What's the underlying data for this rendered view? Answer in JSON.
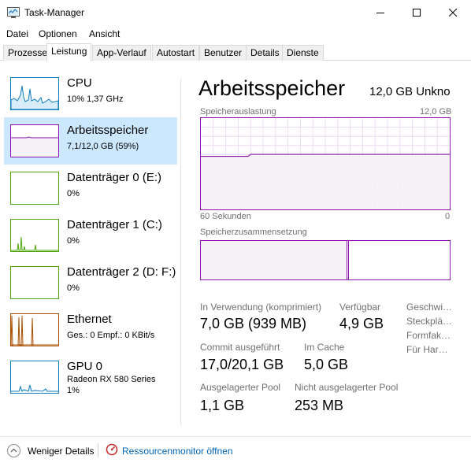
{
  "window": {
    "title": "Task-Manager",
    "app_icon": "task-manager-icon",
    "controls": {
      "minimize": "minimize-icon",
      "maximize": "maximize-icon",
      "close": "close-icon"
    }
  },
  "menu": [
    "Datei",
    "Optionen",
    "Ansicht"
  ],
  "tabs": [
    {
      "label": "Prozesse",
      "active": false
    },
    {
      "label": "Leistung",
      "active": true
    },
    {
      "label": "App-Verlauf",
      "active": false
    },
    {
      "label": "Autostart",
      "active": false
    },
    {
      "label": "Benutzer",
      "active": false
    },
    {
      "label": "Details",
      "active": false
    },
    {
      "label": "Dienste",
      "active": false
    }
  ],
  "devices": [
    {
      "name": "CPU",
      "line1": "10% 1,37 GHz",
      "line2": "",
      "color": "#117dbb"
    },
    {
      "name": "Arbeitsspeicher",
      "line1": "7,1/12,0 GB (59%)",
      "line2": "",
      "color": "#8b12ae",
      "selected": true
    },
    {
      "name": "Datenträger 0 (E:)",
      "line1": "0%",
      "line2": "",
      "color": "#4da60c"
    },
    {
      "name": "Datenträger 1 (C:)",
      "line1": "0%",
      "line2": "",
      "color": "#4da60c"
    },
    {
      "name": "Datenträger 2 (D: F:)",
      "line1": "0%",
      "line2": "",
      "color": "#4da60c"
    },
    {
      "name": "Ethernet",
      "line1": "Ges.: 0 Empf.: 0 KBit/s",
      "line2": "",
      "color": "#a74f01"
    },
    {
      "name": "GPU 0",
      "line1": "Radeon RX 580 Series",
      "line2": "1%",
      "color": "#117dbb"
    }
  ],
  "memory": {
    "title": "Arbeitsspeicher",
    "capacity": "12,0 GB Unkno",
    "usage_graph": {
      "label": "Speicherauslastung",
      "max_label": "12,0 GB",
      "left_axis": "60 Sekunden",
      "right_axis": "0",
      "usage_fraction": 0.59
    },
    "composition": {
      "label": "Speicherzusammensetzung",
      "in_use_fraction": 0.59,
      "modified_fraction": 0.005
    },
    "stats": {
      "in_use_label": "In Verwendung (komprimiert)",
      "in_use_value": "7,0 GB (939 MB)",
      "available_label": "Verfügbar",
      "available_value": "4,9 GB",
      "committed_label": "Commit ausgeführt",
      "committed_value": "17,0/20,1 GB",
      "cached_label": "Im Cache",
      "cached_value": "5,0 GB",
      "paged_label": "Ausgelagerter Pool",
      "paged_value": "1,1 GB",
      "nonpaged_label": "Nicht ausgelagerter Pool",
      "nonpaged_value": "253 MB"
    },
    "side_labels": [
      "Geschwi…",
      "Steckplä…",
      "Formfak…",
      "Für Har…"
    ]
  },
  "footer": {
    "fewer_details": "Weniger Details",
    "fewer_icon": "chevron-up-circle-icon",
    "resource_monitor": "Ressourcenmonitor öffnen",
    "resource_icon": "resource-monitor-icon"
  },
  "colors": {
    "memory_accent": "#8b12ae",
    "selection_bg": "#cce8ff",
    "link": "#0063b1"
  }
}
